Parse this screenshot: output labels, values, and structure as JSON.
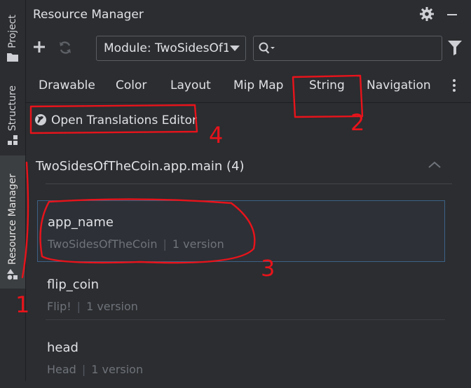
{
  "sidebar": {
    "tabs": [
      {
        "label": "Project",
        "icon": "folder-icon"
      },
      {
        "label": "Structure",
        "icon": "structure-icon"
      },
      {
        "label": "Resource Manager",
        "icon": "resource-manager-icon",
        "active": true
      }
    ]
  },
  "header": {
    "title": "Resource Manager"
  },
  "toolbar": {
    "module_value": "Module: TwoSidesOf1",
    "search_placeholder": ""
  },
  "tabs": [
    {
      "label": "Drawable"
    },
    {
      "label": "Color"
    },
    {
      "label": "Layout"
    },
    {
      "label": "Mip Map"
    },
    {
      "label": "String",
      "active": true
    },
    {
      "label": "Navigation"
    }
  ],
  "actions": {
    "open_translations": "Open Translations Editor"
  },
  "group": {
    "title": "TwoSidesOfTheCoin.app.main (4)"
  },
  "resources": [
    {
      "name": "app_name",
      "value": "TwoSidesOfTheCoin",
      "versions": "1 version",
      "selected": true
    },
    {
      "name": "flip_coin",
      "value": "Flip!",
      "versions": "1 version"
    },
    {
      "name": "head",
      "value": "Head",
      "versions": "1 version"
    }
  ],
  "annotations": [
    "1",
    "2",
    "3",
    "4"
  ],
  "colors": {
    "accent": "#3574f0",
    "annotation": "#e8131b",
    "background": "#2b2d30"
  }
}
